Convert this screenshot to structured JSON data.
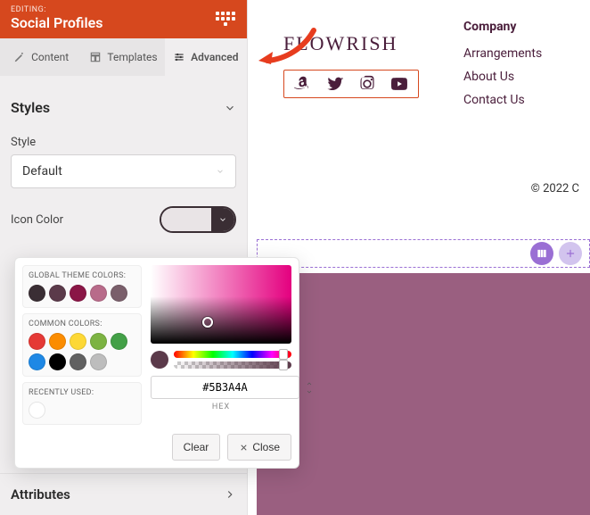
{
  "header": {
    "editing_label": "EDITING:",
    "title": "Social Profiles"
  },
  "tabs": {
    "content": "Content",
    "templates": "Templates",
    "advanced": "Advanced"
  },
  "sections": {
    "styles": "Styles",
    "attributes": "Attributes"
  },
  "fields": {
    "style_label": "Style",
    "style_value": "Default",
    "icon_color_label": "Icon Color"
  },
  "color_picker": {
    "global_label": "GLOBAL THEME COLORS:",
    "global_colors": [
      "#3a2e34",
      "#5b3a4a",
      "#8a1646",
      "#b86b8a",
      "#7a5f6b"
    ],
    "common_label": "COMMON COLORS:",
    "common_colors": [
      "#e53935",
      "#fb8c00",
      "#fdd835",
      "#7cb342",
      "#43a047",
      "#1e88e5",
      "#000000",
      "#616161",
      "#bdbdbd"
    ],
    "recent_label": "RECENTLY USED:",
    "recent_colors": [
      "#ffffff"
    ],
    "hex_value": "#5B3A4A",
    "hex_label": "HEX",
    "clear": "Clear",
    "close": "Close"
  },
  "preview": {
    "logo": "FLOWRISH",
    "company_heading": "Company",
    "links": {
      "arrangements": "Arrangements",
      "about": "About Us",
      "contact": "Contact Us"
    },
    "copyright": "© 2022 C"
  }
}
